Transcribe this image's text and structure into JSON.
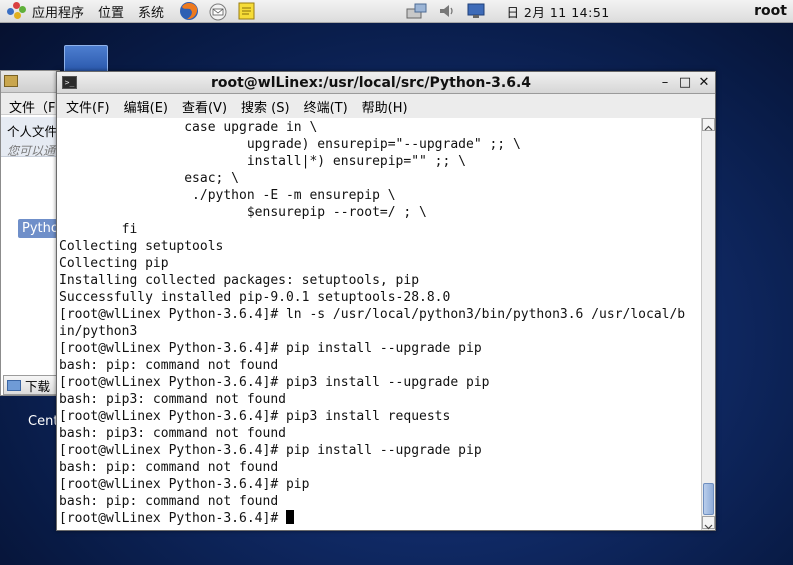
{
  "panel": {
    "applications": "应用程序",
    "places": "位置",
    "system": "系统",
    "clock": "日 2月 11 14:51",
    "user": "root"
  },
  "background_window": {
    "menu_file": "文件（F",
    "personal_folder": "个人文件",
    "hint": "您可以通",
    "python_folder": "Pytho",
    "downloads": "下载"
  },
  "desktop": {
    "centos_label": "Cent"
  },
  "terminal": {
    "title": "root@wlLinex:/usr/local/src/Python-3.6.4",
    "menu": [
      "文件(F)",
      "编辑(E)",
      "查看(V)",
      "搜索 (S)",
      "终端(T)",
      "帮助(H)"
    ],
    "lines": [
      "                case upgrade in \\",
      "                        upgrade) ensurepip=\"--upgrade\" ;; \\",
      "                        install|*) ensurepip=\"\" ;; \\",
      "                esac; \\",
      "                 ./python -E -m ensurepip \\",
      "                        $ensurepip --root=/ ; \\",
      "        fi",
      "Collecting setuptools",
      "Collecting pip",
      "Installing collected packages: setuptools, pip",
      "Successfully installed pip-9.0.1 setuptools-28.8.0",
      "[root@wlLinex Python-3.6.4]# ln -s /usr/local/python3/bin/python3.6 /usr/local/b",
      "in/python3",
      "[root@wlLinex Python-3.6.4]# pip install --upgrade pip",
      "bash: pip: command not found",
      "[root@wlLinex Python-3.6.4]# pip3 install --upgrade pip",
      "bash: pip3: command not found",
      "[root@wlLinex Python-3.6.4]# pip3 install requests",
      "bash: pip3: command not found",
      "[root@wlLinex Python-3.6.4]# pip install --upgrade pip",
      "bash: pip: command not found",
      "[root@wlLinex Python-3.6.4]# pip",
      "bash: pip: command not found"
    ],
    "prompt": "[root@wlLinex Python-3.6.4]# "
  },
  "icons": {
    "apps_logo": "gnome-foot-icon",
    "firefox": "firefox-icon",
    "mail": "mail-icon",
    "notes": "notes-icon",
    "network": "network-icon",
    "volume": "volume-icon",
    "display": "display-icon"
  },
  "colors": {
    "desktop_bg": "#0b2259",
    "panel_bg": "#e4e4e4",
    "terminal_bg": "#ffffff",
    "terminal_fg": "#111111",
    "scrollbar_thumb": "#8fadd9"
  }
}
